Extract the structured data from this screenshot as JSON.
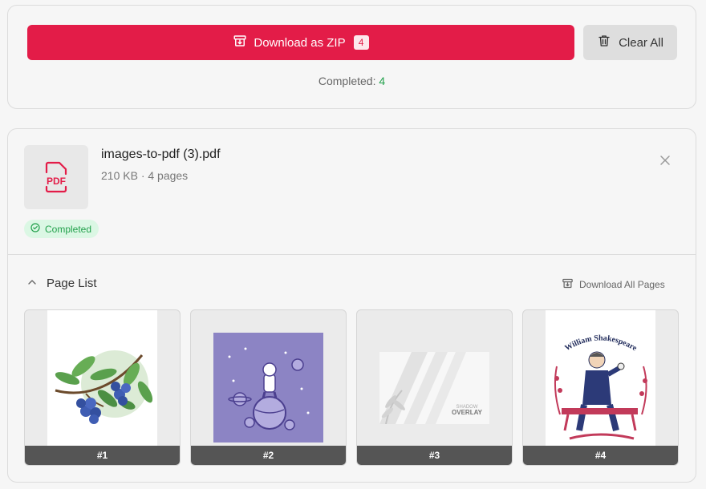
{
  "toolbar": {
    "zip_label": "Download as ZIP",
    "zip_count": "4",
    "clear_label": "Clear All",
    "completed_prefix": "Completed:",
    "completed_count": "4"
  },
  "file": {
    "icon_text": "PDF",
    "name": "images-to-pdf (3).pdf",
    "meta": "210 KB · 4 pages",
    "status": "Completed"
  },
  "page_list": {
    "title": "Page List",
    "download_all": "Download All Pages",
    "pages": [
      {
        "label": "#1"
      },
      {
        "label": "#2"
      },
      {
        "label": "#3",
        "text_top": "SHADOW",
        "text_main": "OVERLAY"
      },
      {
        "label": "#4",
        "text_title": "William Shakespeare"
      }
    ]
  },
  "colors": {
    "accent": "#e31c48",
    "success": "#22a04b",
    "success_bg": "#dbf7e4"
  }
}
